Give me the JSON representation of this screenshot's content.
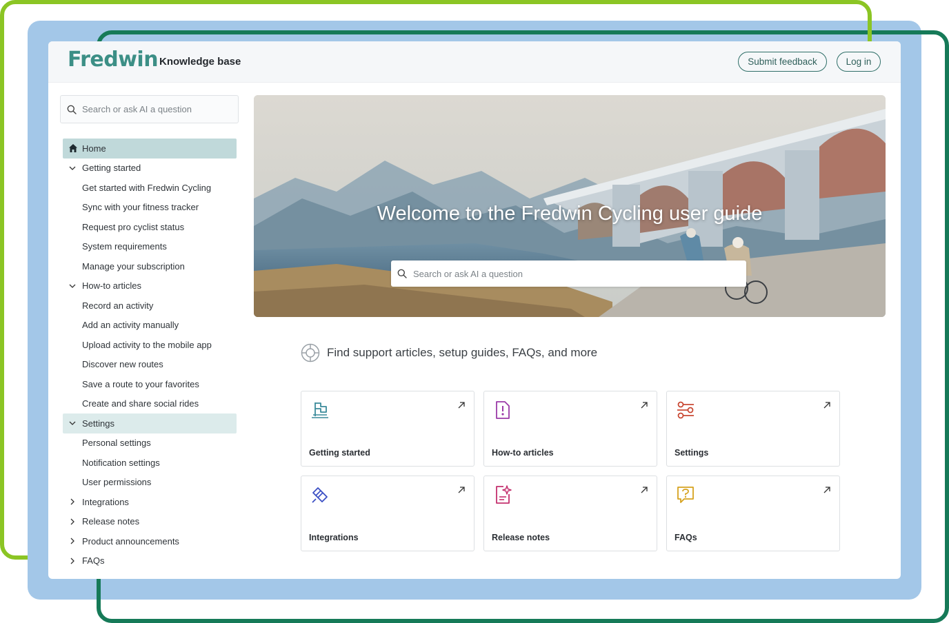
{
  "header": {
    "brand": "Fredwin",
    "subtitle": "Knowledge base",
    "feedback_label": "Submit feedback",
    "login_label": "Log in"
  },
  "sidebar": {
    "search_placeholder": "Search or ask AI a question",
    "items": [
      {
        "label": "Home"
      },
      {
        "label": "Getting started"
      },
      {
        "label": "Get started with Fredwin Cycling"
      },
      {
        "label": "Sync with your fitness tracker"
      },
      {
        "label": "Request pro cyclist status"
      },
      {
        "label": "System requirements"
      },
      {
        "label": "Manage your subscription"
      },
      {
        "label": "How-to articles"
      },
      {
        "label": "Record an activity"
      },
      {
        "label": "Add an activity manually"
      },
      {
        "label": "Upload activity to the mobile app"
      },
      {
        "label": "Discover new routes"
      },
      {
        "label": "Save a route to your favorites"
      },
      {
        "label": "Create and share social rides"
      },
      {
        "label": "Settings"
      },
      {
        "label": "Personal settings"
      },
      {
        "label": "Notification settings"
      },
      {
        "label": "User permissions"
      },
      {
        "label": "Integrations"
      },
      {
        "label": "Release notes"
      },
      {
        "label": "Product announcements"
      },
      {
        "label": "FAQs"
      }
    ]
  },
  "hero": {
    "title": "Welcome to the Fredwin Cycling user guide",
    "search_placeholder": "Search or ask AI a question"
  },
  "support": {
    "text": "Find support articles, setup guides, FAQs, and more"
  },
  "cards": [
    {
      "label": "Getting started",
      "icon": "flag-icon",
      "color": "#3a8a9a"
    },
    {
      "label": "How-to articles",
      "icon": "document-info-icon",
      "color": "#9b3aa8"
    },
    {
      "label": "Settings",
      "icon": "sliders-icon",
      "color": "#c7442e"
    },
    {
      "label": "Integrations",
      "icon": "plug-icon",
      "color": "#3b4fc4"
    },
    {
      "label": "Release notes",
      "icon": "document-sparkle-icon",
      "color": "#c4306e"
    },
    {
      "label": "FAQs",
      "icon": "question-chat-icon",
      "color": "#d6a21e"
    }
  ],
  "colors": {
    "brand": "#3c8f86",
    "nav_active": "#c0d9da",
    "frame_green": "#8bc524",
    "frame_blue": "#a3c7e8",
    "frame_teal": "#167a58"
  }
}
